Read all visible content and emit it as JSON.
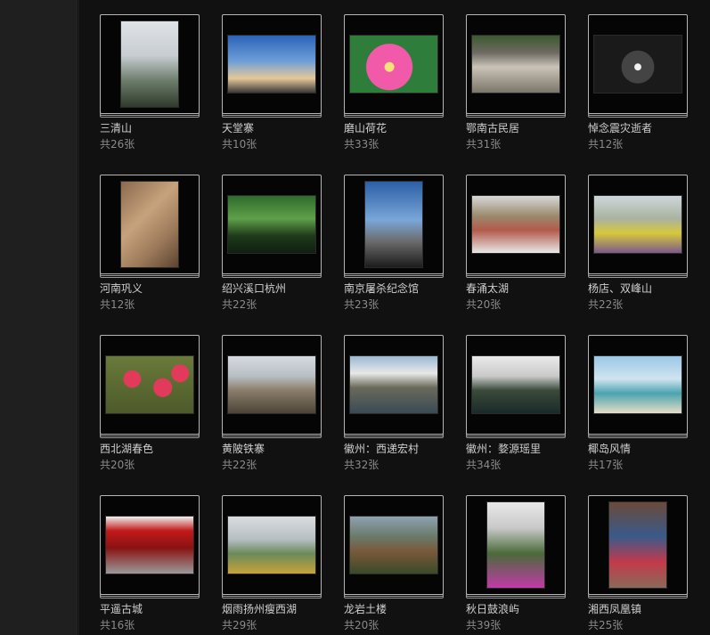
{
  "count_prefix": "共",
  "count_suffix": "张",
  "albums": [
    {
      "title": "三清山",
      "count": "26",
      "orient": "tall",
      "bg": "linear-gradient(180deg,#dfe3e6 0%,#c7cdd2 40%,#6b7b6a 70%,#2f3a2d 100%)"
    },
    {
      "title": "天堂寨",
      "count": "10",
      "orient": "wide",
      "bg": "linear-gradient(180deg,#2c63b8 0%,#6e9fd8 45%,#e6c89a 75%,#3a3a3a 100%)"
    },
    {
      "title": "磨山荷花",
      "count": "33",
      "orient": "wide",
      "bg": "radial-gradient(circle at 45% 55%,#f6e27a 0 8%,#f05aa8 9% 40%,#2f7d3a 41% 100%)"
    },
    {
      "title": "鄂南古民居",
      "count": "31",
      "orient": "wide",
      "bg": "linear-gradient(180deg,#3b5a2e 0%,#6e6a62 30%,#c9c3b8 55%,#7c756a 100%)"
    },
    {
      "title": "悼念震灾逝者",
      "count": "12",
      "orient": "wide",
      "bg": "radial-gradient(circle at 50% 55%,#f2f2f2 0 6%,#444 7% 30%,#1a1a1a 31% 100%)"
    },
    {
      "title": "河南巩义",
      "count": "12",
      "orient": "tall",
      "bg": "linear-gradient(135deg,#8a6a4e 0%,#c7a27c 40%,#9c7a5a 70%,#5b4331 100%)"
    },
    {
      "title": "绍兴溪口杭州",
      "count": "22",
      "orient": "wide",
      "bg": "linear-gradient(180deg,#2f6b2c 0%,#5fa04a 40%,#1e3a1a 70%,#0f1f10 100%)"
    },
    {
      "title": "南京屠杀纪念馆",
      "count": "23",
      "orient": "tall",
      "bg": "linear-gradient(180deg,#2b5fa6 0%,#7aa6d8 45%,#6b6b6b 70%,#1c1c1c 100%)"
    },
    {
      "title": "春涌太湖",
      "count": "20",
      "orient": "wide",
      "bg": "linear-gradient(180deg,#d8d8d8 0%,#9b8a6e 35%,#b35a4a 60%,#e8e8e8 100%)"
    },
    {
      "title": "杨店、双峰山",
      "count": "22",
      "orient": "wide",
      "bg": "linear-gradient(180deg,#cfd6db 0%,#a9b3a0 40%,#d7c93c 65%,#7b5a8a 100%)"
    },
    {
      "title": "西北湖春色",
      "count": "20",
      "orient": "wide",
      "bg": "radial-gradient(circle at 30% 40%,#e23a5a 0 12%,transparent 13%),radial-gradient(circle at 65% 55%,#e23a5a 0 14%,transparent 15%),radial-gradient(circle at 85% 30%,#e23a5a 0 10%,transparent 11%),linear-gradient(180deg,#6a7a3a 0%,#4d5a2a 100%)"
    },
    {
      "title": "黄陂铁寨",
      "count": "22",
      "orient": "wide",
      "bg": "linear-gradient(180deg,#d5dbe0 0%,#b8bfc4 35%,#8a7d6a 60%,#4d4437 100%)"
    },
    {
      "title": "徽州：西递宏村",
      "count": "32",
      "orient": "wide",
      "bg": "linear-gradient(180deg,#9bb9d2 0%,#e8e8e8 30%,#6a6a5a 55%,#3a4a55 100%)"
    },
    {
      "title": "徽州：婺源瑶里",
      "count": "34",
      "orient": "wide",
      "bg": "linear-gradient(180deg,#eaeaea 0%,#c9c9c9 35%,#3a4a3a 60%,#1a2a2a 100%)"
    },
    {
      "title": "椰岛风情",
      "count": "17",
      "orient": "wide",
      "bg": "linear-gradient(180deg,#9cc8e8 0%,#cfe4f0 40%,#4ba3b0 65%,#e6ddc6 100%)"
    },
    {
      "title": "平遥古城",
      "count": "16",
      "orient": "wide",
      "bg": "linear-gradient(180deg,#efefef 0%,#c21a1a 25%,#8a1212 55%,#9a9a9a 100%)"
    },
    {
      "title": "烟雨扬州瘦西湖",
      "count": "29",
      "orient": "wide",
      "bg": "linear-gradient(180deg,#d9dde0 0%,#b7bec2 40%,#6a8a5a 65%,#c9a23a 100%)"
    },
    {
      "title": "龙岩土楼",
      "count": "20",
      "orient": "wide",
      "bg": "linear-gradient(180deg,#8fa2b0 0%,#6a7a6a 35%,#7a5a3a 60%,#3a4a2a 100%)"
    },
    {
      "title": "秋日鼓浪屿",
      "count": "39",
      "orient": "tall",
      "bg": "linear-gradient(180deg,#e8e8e8 0%,#c9c9c9 30%,#4a6a3a 60%,#c23aa8 100%)"
    },
    {
      "title": "湘西凤凰镇",
      "count": "25",
      "orient": "tall",
      "bg": "linear-gradient(180deg,#6a4a3a 0%,#3a5a8a 40%,#c23a4a 70%,#8a6a5a 100%)"
    }
  ]
}
